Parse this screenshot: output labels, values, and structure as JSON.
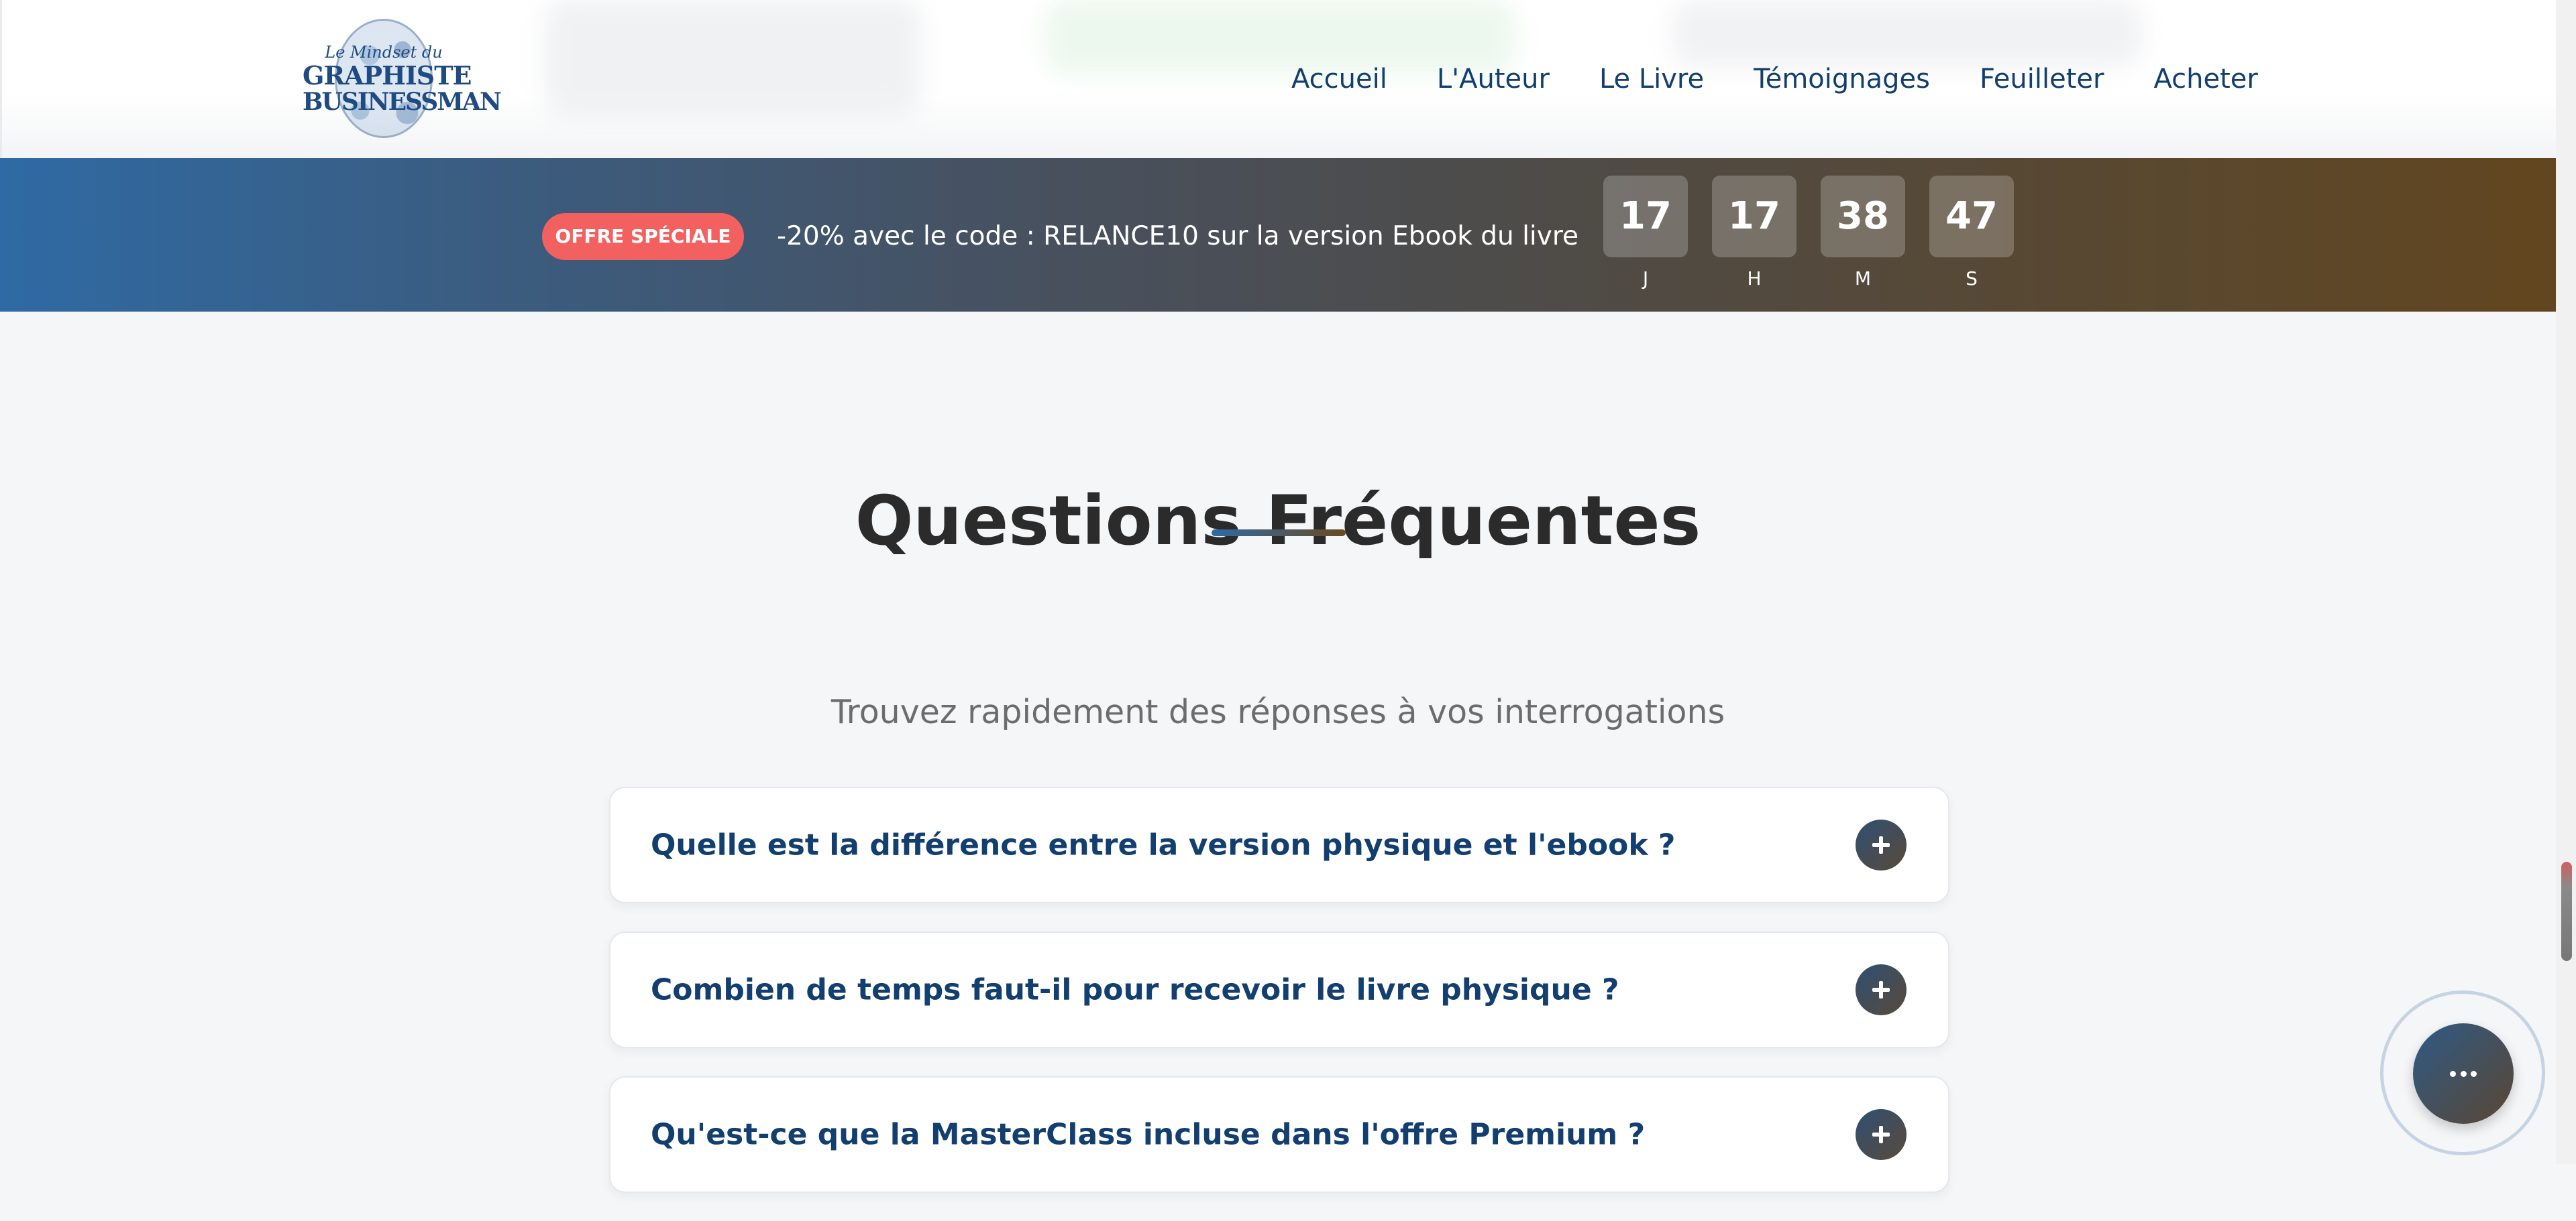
{
  "header": {
    "logo": {
      "line1": "Le Mindset du",
      "line2": "GRAPHISTE",
      "line3": "BUSINESSMAN"
    },
    "nav": [
      {
        "label": "Accueil"
      },
      {
        "label": "L'Auteur"
      },
      {
        "label": "Le Livre"
      },
      {
        "label": "Témoignages"
      },
      {
        "label": "Feuilleter"
      },
      {
        "label": "Acheter"
      }
    ]
  },
  "promo": {
    "badge": "OFFRE SPÉCIALE",
    "text": "-20% avec le code : RELANCE10 sur la version Ebook du livre",
    "countdown": [
      {
        "value": "17",
        "label": "J"
      },
      {
        "value": "17",
        "label": "H"
      },
      {
        "value": "38",
        "label": "M"
      },
      {
        "value": "47",
        "label": "S"
      }
    ]
  },
  "faq": {
    "title": "Questions Fréquentes",
    "subtitle": "Trouvez rapidement des réponses à vos interrogations",
    "items": [
      {
        "question": "Quelle est la différence entre la version physique et l'ebook ?"
      },
      {
        "question": "Combien de temps faut-il pour recevoir le livre physique ?"
      },
      {
        "question": "Qu'est-ce que la MasterClass incluse dans l'offre Premium ?"
      }
    ]
  },
  "colors": {
    "nav_text": "#123f70",
    "badge": "#f36060",
    "banner_start": "#2f6aa4",
    "banner_end": "#62461f",
    "title_text": "#2b2b2b"
  },
  "icons": {
    "faq_toggle": "plus-icon",
    "chat_button": "more-dots-icon"
  }
}
